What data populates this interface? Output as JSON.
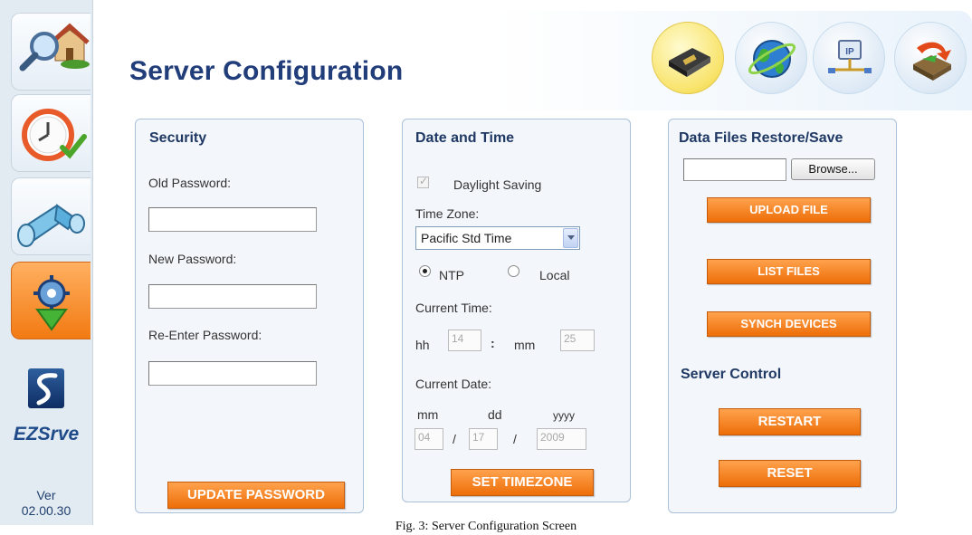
{
  "sidebar": {
    "items": [
      {
        "icon": "search-house-icon"
      },
      {
        "icon": "clock-check-icon"
      },
      {
        "icon": "pipe-icon"
      },
      {
        "icon": "gear-download-icon",
        "active": true
      }
    ],
    "logo_text": "EZSrve",
    "version_label": "Ver",
    "version": "02.00.30"
  },
  "header": {
    "title": "Server Configuration",
    "icons": [
      "server-icon",
      "globe-icon",
      "network-ip-icon",
      "restore-arrow-icon"
    ],
    "ip_glyph": "IP"
  },
  "security": {
    "title": "Security",
    "old_password_label": "Old Password:",
    "new_password_label": "New Password:",
    "reenter_password_label": "Re-Enter Password:",
    "update_button": "UPDATE PASSWORD"
  },
  "datetime": {
    "title": "Date and Time",
    "daylight_label": "Daylight Saving",
    "timezone_label": "Time Zone:",
    "timezone_value": "Pacific Std Time",
    "ntp_label": "NTP",
    "local_label": "Local",
    "current_time_label": "Current Time:",
    "hh_label": "hh",
    "hh_value": "14",
    "colon": ":",
    "mm_label": "mm",
    "mm_value": "25",
    "current_date_label": "Current Date:",
    "date_mm_label": "mm",
    "date_dd_label": "dd",
    "date_yyyy_label": "yyyy",
    "date_mm_value": "04",
    "date_dd_value": "17",
    "date_yyyy_value": "2009",
    "slash": "/",
    "set_button": "SET TIMEZONE"
  },
  "datafiles": {
    "title": "Data Files Restore/Save",
    "browse_button": "Browse...",
    "upload_button": "UPLOAD FILE",
    "list_button": "LIST FILES",
    "synch_button": "SYNCH DEVICES",
    "server_control_title": "Server Control",
    "restart_button": "RESTART",
    "reset_button": "RESET"
  },
  "caption": "Fig. 3: Server Configuration Screen"
}
